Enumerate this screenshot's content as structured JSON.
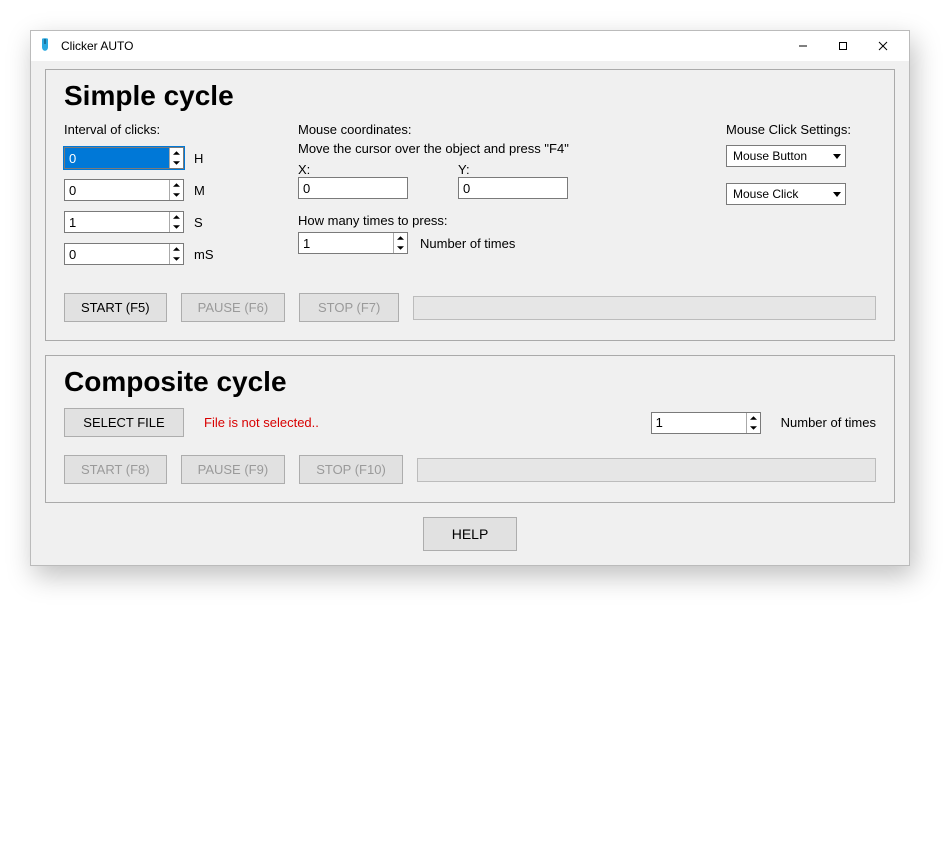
{
  "window": {
    "title": "Clicker AUTO"
  },
  "simple": {
    "legend": "Simple cycle",
    "interval_label": "Interval of clicks:",
    "hours": "0",
    "minutes": "0",
    "seconds": "1",
    "ms": "0",
    "unit_h": "H",
    "unit_m": "M",
    "unit_s": "S",
    "unit_ms": "mS",
    "coords_label": "Mouse coordinates:",
    "coords_hint": "Move the cursor over the object and press \"F4\"",
    "x_label": "X:",
    "y_label": "Y:",
    "x": "0",
    "y": "0",
    "presses_label": "How many times to press:",
    "presses": "1",
    "presses_suffix": "Number of times",
    "settings_label": "Mouse Click Settings:",
    "button_select": "Mouse Button",
    "click_select": "Mouse Click",
    "start": "START (F5)",
    "pause": "PAUSE (F6)",
    "stop": "STOP (F7)"
  },
  "composite": {
    "legend": "Composite cycle",
    "select_file": "SELECT FILE",
    "file_status": "File is not selected..",
    "times": "1",
    "times_suffix": "Number of times",
    "start": "START (F8)",
    "pause": "PAUSE (F9)",
    "stop": "STOP (F10)"
  },
  "help": "HELP"
}
